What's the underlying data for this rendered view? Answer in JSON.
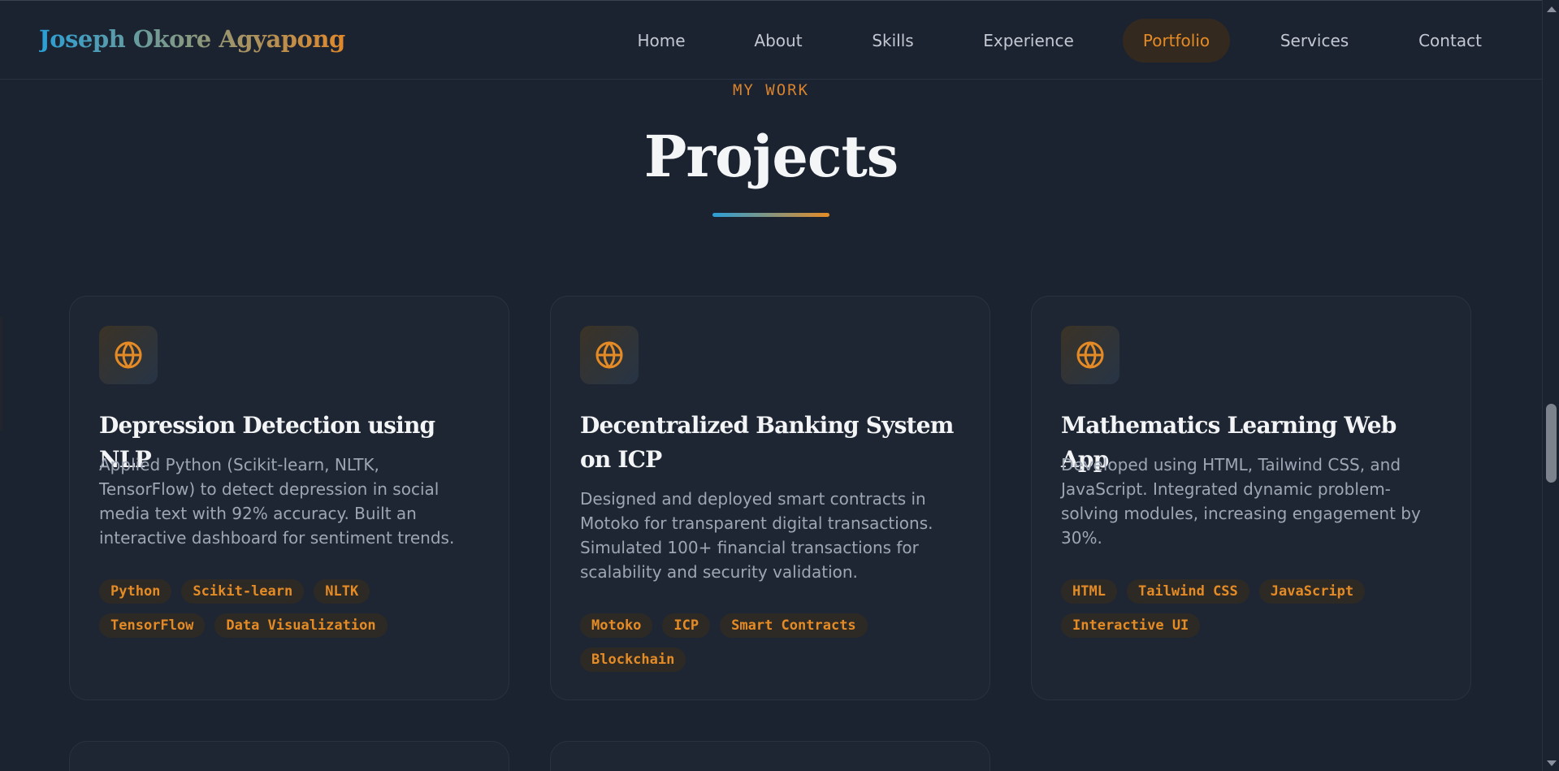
{
  "brand": {
    "name": "Joseph Okore Agyapong"
  },
  "nav": {
    "items": [
      {
        "label": "Home",
        "active": false
      },
      {
        "label": "About",
        "active": false
      },
      {
        "label": "Skills",
        "active": false
      },
      {
        "label": "Experience",
        "active": false
      },
      {
        "label": "Portfolio",
        "active": true
      },
      {
        "label": "Services",
        "active": false
      },
      {
        "label": "Contact",
        "active": false
      }
    ]
  },
  "section": {
    "eyebrow": "MY WORK",
    "title": "Projects"
  },
  "projects": [
    {
      "icon": "globe-icon",
      "title": "Depression Detection using NLP",
      "description": "Applied Python (Scikit-learn, NLTK, TensorFlow) to detect depression in social media text with 92% accuracy. Built an interactive dashboard for sentiment trends.",
      "tags": [
        "Python",
        "Scikit-learn",
        "NLTK",
        "TensorFlow",
        "Data Visualization"
      ]
    },
    {
      "icon": "globe-icon",
      "title": "Decentralized Banking System on ICP",
      "description": "Designed and deployed smart contracts in Motoko for transparent digital transactions. Simulated 100+ financial transactions for scalability and security validation.",
      "tags": [
        "Motoko",
        "ICP",
        "Smart Contracts",
        "Blockchain"
      ]
    },
    {
      "icon": "globe-icon",
      "title": "Mathematics Learning Web App",
      "description": "Developed using HTML, Tailwind CSS, and JavaScript. Integrated dynamic problem-solving modules, increasing engagement by 30%.",
      "tags": [
        "HTML",
        "Tailwind CSS",
        "JavaScript",
        "Interactive UI"
      ]
    }
  ],
  "colors": {
    "accent": "#e58b25",
    "brand_blue": "#2a9fd6",
    "background": "#1b2230",
    "card": "#1f2633"
  }
}
